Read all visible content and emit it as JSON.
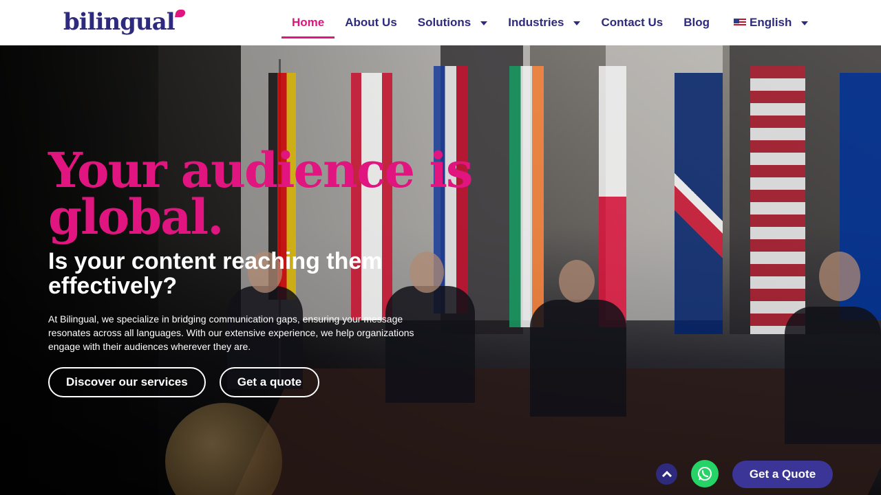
{
  "brand": {
    "logo_text": "bilingual",
    "accent": "#e0157f",
    "primary": "#2e2a7d"
  },
  "nav": {
    "items": [
      {
        "label": "Home",
        "active": true,
        "has_dropdown": false
      },
      {
        "label": "About Us",
        "active": false,
        "has_dropdown": false
      },
      {
        "label": "Solutions",
        "active": false,
        "has_dropdown": true
      },
      {
        "label": "Industries",
        "active": false,
        "has_dropdown": true
      },
      {
        "label": "Contact Us",
        "active": false,
        "has_dropdown": false
      },
      {
        "label": "Blog",
        "active": false,
        "has_dropdown": false
      }
    ],
    "language": {
      "label": "English",
      "icon": "us-flag-icon"
    }
  },
  "hero": {
    "headline": "Your audience is global.",
    "subheadline": "Is your content reaching them effectively?",
    "description": "At Bilingual, we specialize in bridging communication gaps, ensuring your message resonates across all languages. With our extensive experience, we help organizations engage with their audiences wherever they are.",
    "buttons": {
      "primary": "Discover our services",
      "secondary": "Get a quote"
    }
  },
  "floating": {
    "scroll_top_icon": "chevron-up-icon",
    "whatsapp_icon": "whatsapp-icon",
    "quote_label": "Get a Quote"
  }
}
